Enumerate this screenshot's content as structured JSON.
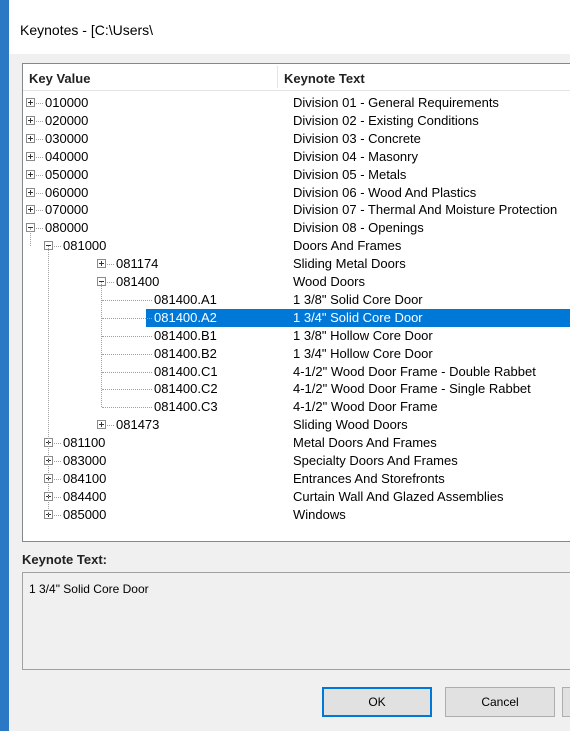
{
  "window": {
    "title": "Keynotes - [C:\\Users\\"
  },
  "tree": {
    "columns": {
      "key": "Key Value",
      "text": "Keynote Text"
    },
    "rows": [
      {
        "key": "010000",
        "text": "Division 01 - General Requirements",
        "level": 0,
        "expander": "plus",
        "selected": false
      },
      {
        "key": "020000",
        "text": "Division 02 - Existing Conditions",
        "level": 0,
        "expander": "plus",
        "selected": false
      },
      {
        "key": "030000",
        "text": "Division 03 - Concrete",
        "level": 0,
        "expander": "plus",
        "selected": false
      },
      {
        "key": "040000",
        "text": "Division 04 - Masonry",
        "level": 0,
        "expander": "plus",
        "selected": false
      },
      {
        "key": "050000",
        "text": "Division 05 - Metals",
        "level": 0,
        "expander": "plus",
        "selected": false
      },
      {
        "key": "060000",
        "text": "Division 06 - Wood And Plastics",
        "level": 0,
        "expander": "plus",
        "selected": false
      },
      {
        "key": "070000",
        "text": "Division 07 - Thermal And Moisture Protection",
        "level": 0,
        "expander": "plus",
        "selected": false
      },
      {
        "key": "080000",
        "text": "Division 08 - Openings",
        "level": 0,
        "expander": "minus",
        "selected": false
      },
      {
        "key": "081000",
        "text": "Doors And Frames",
        "level": 1,
        "expander": "minus",
        "selected": false
      },
      {
        "key": "081174",
        "text": "Sliding Metal Doors",
        "level": 2,
        "expander": "plus",
        "selected": false
      },
      {
        "key": "081400",
        "text": "Wood Doors",
        "level": 2,
        "expander": "minus",
        "selected": false
      },
      {
        "key": "081400.A1",
        "text": "1 3/8\" Solid Core Door",
        "level": 3,
        "expander": "none",
        "selected": false
      },
      {
        "key": "081400.A2",
        "text": "1 3/4\" Solid Core Door",
        "level": 3,
        "expander": "none",
        "selected": true
      },
      {
        "key": "081400.B1",
        "text": "1 3/8\" Hollow Core Door",
        "level": 3,
        "expander": "none",
        "selected": false
      },
      {
        "key": "081400.B2",
        "text": "1 3/4\" Hollow Core Door",
        "level": 3,
        "expander": "none",
        "selected": false
      },
      {
        "key": "081400.C1",
        "text": "4-1/2\" Wood Door Frame - Double Rabbet",
        "level": 3,
        "expander": "none",
        "selected": false
      },
      {
        "key": "081400.C2",
        "text": "4-1/2\" Wood Door Frame - Single Rabbet",
        "level": 3,
        "expander": "none",
        "selected": false
      },
      {
        "key": "081400.C3",
        "text": "4-1/2\" Wood Door Frame",
        "level": 3,
        "expander": "none",
        "selected": false
      },
      {
        "key": "081473",
        "text": "Sliding Wood Doors",
        "level": 2,
        "expander": "plus",
        "selected": false
      },
      {
        "key": "081100",
        "text": "Metal Doors And Frames",
        "level": 1,
        "expander": "plus",
        "selected": false
      },
      {
        "key": "083000",
        "text": "Specialty Doors And Frames",
        "level": 1,
        "expander": "plus",
        "selected": false
      },
      {
        "key": "084100",
        "text": "Entrances And Storefronts",
        "level": 1,
        "expander": "plus",
        "selected": false
      },
      {
        "key": "084400",
        "text": "Curtain Wall And Glazed Assemblies",
        "level": 1,
        "expander": "plus",
        "selected": false
      },
      {
        "key": "085000",
        "text": "Windows",
        "level": 1,
        "expander": "plus",
        "selected": false
      }
    ]
  },
  "details": {
    "label": "Keynote Text:",
    "value": "1 3/4\" Solid Core Door"
  },
  "buttons": {
    "ok": "OK",
    "cancel": "Cancel",
    "extra": ""
  },
  "colors": {
    "selection": "#0078d7",
    "window_accent": "#2b78c5"
  }
}
